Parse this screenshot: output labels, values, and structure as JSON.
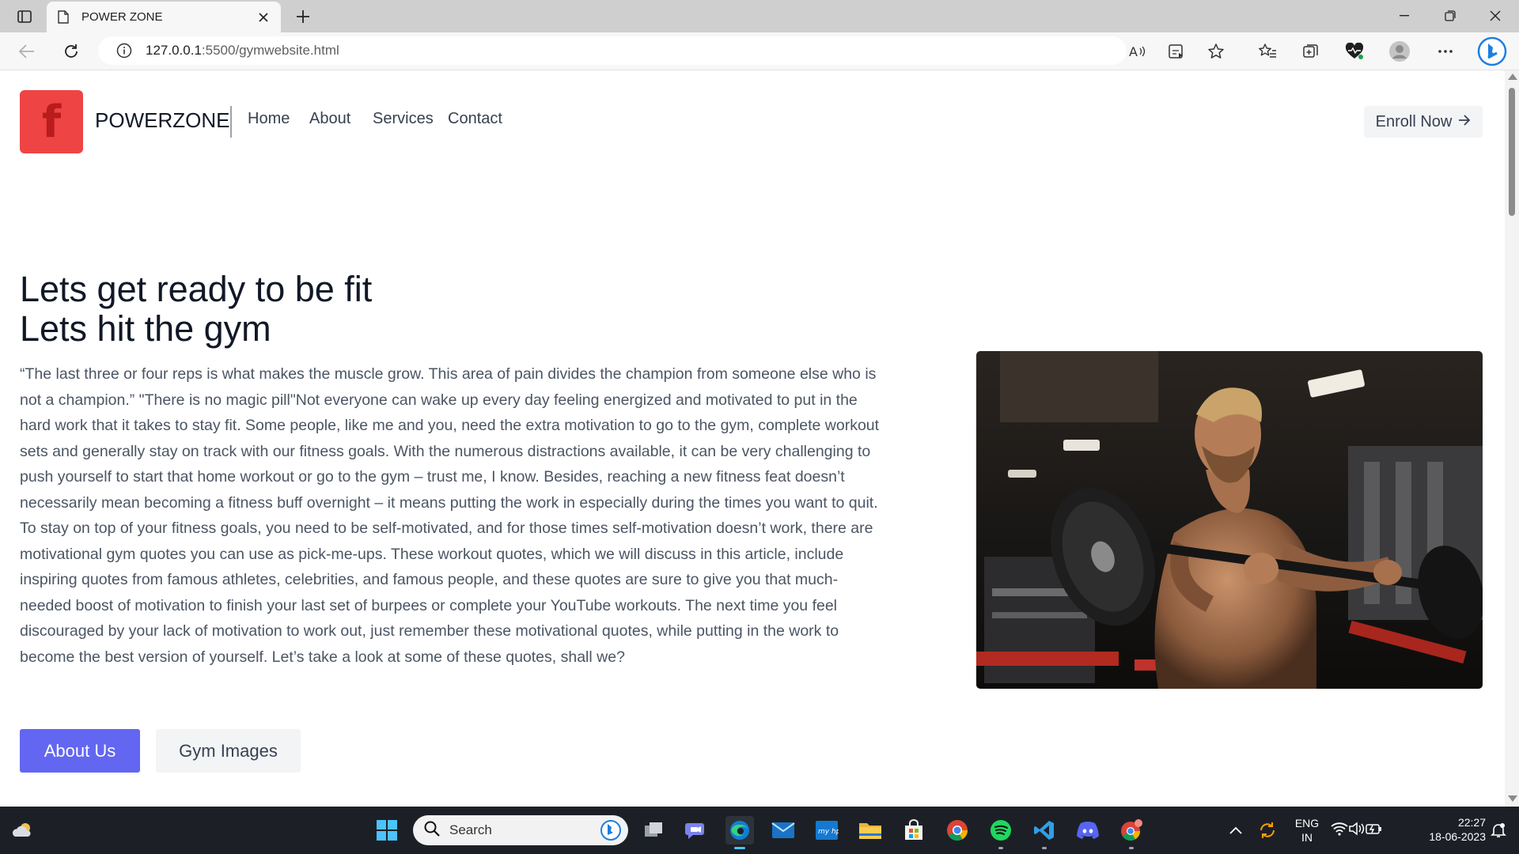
{
  "browser": {
    "tab_title": "POWER ZONE",
    "url_host": "127.0.0.1",
    "url_path": ":5500/gymwebsite.html"
  },
  "site": {
    "logo_letter": "f",
    "brand": "POWERZONE",
    "nav": [
      "Home",
      "About",
      "Services",
      "Contact"
    ],
    "enroll_label": "Enroll Now",
    "headline_line1": "Lets get ready to be fit",
    "headline_line2": "Lets hit the gym",
    "paragraph": "“The last three or four reps is what makes the muscle grow. This area of pain divides the champion from someone else who is not a champion.” \"There is no magic pill\"Not everyone can wake up every day feeling energized and motivated to put in the hard work that it takes to stay fit. Some people, like me and you, need the extra motivation to go to the gym, complete workout sets and generally stay on track with our fitness goals. With the numerous distractions available, it can be very challenging to push yourself to start that home workout or go to the gym – trust me, I know. Besides, reaching a new fitness feat doesn’t necessarily mean becoming a fitness buff overnight – it means putting the work in especially during the times you want to quit. To stay on top of your fitness goals, you need to be self-motivated, and for those times self-motivation doesn’t work, there are motivational gym quotes you can use as pick-me-ups. These workout quotes, which we will discuss in this article, include inspiring quotes from famous athletes, celebrities, and famous people, and these quotes are sure to give you that much-needed boost of motivation to finish your last set of burpees or complete your YouTube workouts. The next time you feel discouraged by your lack of motivation to work out, just remember these motivational quotes, while putting in the work to become the best version of yourself. Let’s take a look at some of these quotes, shall we?",
    "about_button": "About Us",
    "gym_images_button": "Gym Images",
    "accent_color": "#6366f1",
    "logo_color": "#ef4444"
  },
  "taskbar": {
    "search_placeholder": "Search",
    "lang_line1": "ENG",
    "lang_line2": "IN",
    "time": "22:27",
    "date": "18-06-2023"
  }
}
